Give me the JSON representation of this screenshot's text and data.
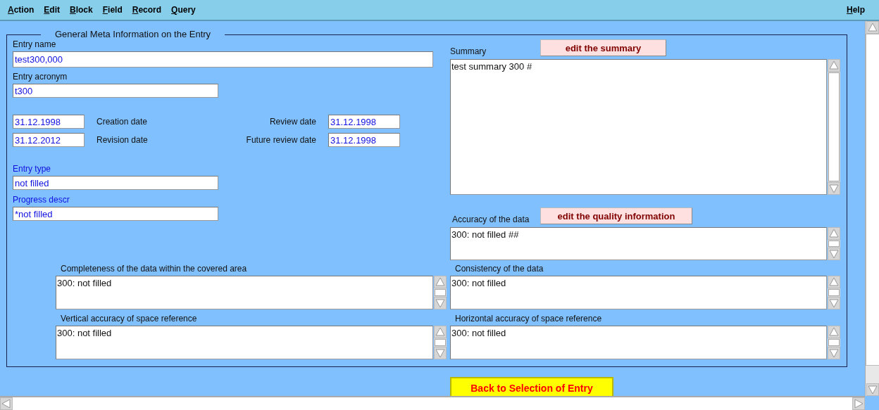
{
  "menu": [
    {
      "label": "Action"
    },
    {
      "label": "Edit"
    },
    {
      "label": "Block"
    },
    {
      "label": "Field"
    },
    {
      "label": "Record"
    },
    {
      "label": "Query"
    }
  ],
  "help": {
    "label": "Help"
  },
  "section": {
    "title": "General Meta Information on the Entry"
  },
  "entry_name": {
    "label": "Entry name",
    "value": "test300,000"
  },
  "entry_acronym": {
    "label": "Entry acronym",
    "value": "t300"
  },
  "dates": [
    {
      "label": "Creation date",
      "value": "31.12.1998"
    },
    {
      "label": "Review date",
      "value": "31.12.1998"
    },
    {
      "label": "Revision date",
      "value": "31.12.2012"
    },
    {
      "label": "Future review date",
      "value": "31.12.1998"
    }
  ],
  "entry_type": {
    "label": "Entry type",
    "value": "not filled"
  },
  "progress_descr": {
    "label": "Progress descr",
    "value": "*not filled"
  },
  "summary": {
    "label": "Summary",
    "button": "edit the summary",
    "value": "test summary 300 #"
  },
  "accuracy": {
    "label": "Accuracy of the data",
    "button": "edit the quality information",
    "value": "300: not filled ##"
  },
  "quality_fields": [
    {
      "label": "Completeness of the data within the covered area",
      "value": "300: not filled"
    },
    {
      "label": "Consistency of the data",
      "value": "300: not filled"
    },
    {
      "label": "Vertical accuracy of space reference",
      "value": "300: not filled"
    },
    {
      "label": "Horizontal accuracy of space reference",
      "value": "300: not filled"
    }
  ],
  "back_button": {
    "label": "Back to Selection of Entry"
  }
}
